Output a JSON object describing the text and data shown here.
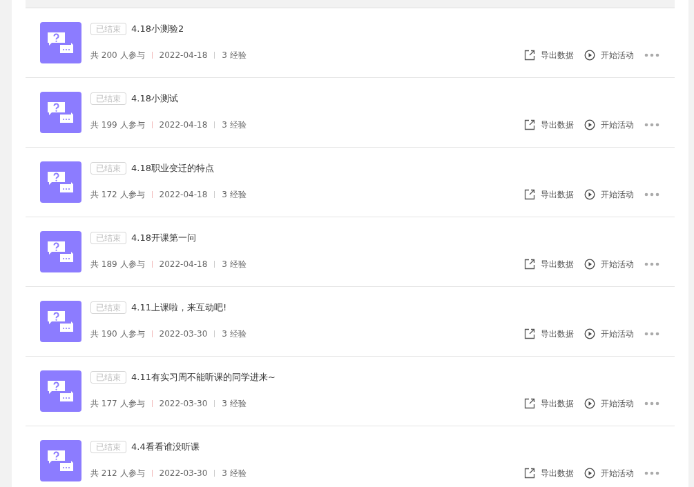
{
  "activities": [
    {
      "status": "已结束",
      "title": "4.18小测验2",
      "participants": "共 200 人参与",
      "date": "2022-04-18",
      "exp": "3 经验",
      "export": "导出数据",
      "start": "开始活动"
    },
    {
      "status": "已结束",
      "title": "4.18小测试",
      "participants": "共 199 人参与",
      "date": "2022-04-18",
      "exp": "3 经验",
      "export": "导出数据",
      "start": "开始活动"
    },
    {
      "status": "已结束",
      "title": "4.18职业变迁的特点",
      "participants": "共 172 人参与",
      "date": "2022-04-18",
      "exp": "3 经验",
      "export": "导出数据",
      "start": "开始活动"
    },
    {
      "status": "已结束",
      "title": "4.18开课第一问",
      "participants": "共 189 人参与",
      "date": "2022-04-18",
      "exp": "3 经验",
      "export": "导出数据",
      "start": "开始活动"
    },
    {
      "status": "已结束",
      "title": "4.11上课啦，来互动吧!",
      "participants": "共 190 人参与",
      "date": "2022-03-30",
      "exp": "3 经验",
      "export": "导出数据",
      "start": "开始活动"
    },
    {
      "status": "已结束",
      "title": "4.11有实习周不能听课的同学进来~",
      "participants": "共 177 人参与",
      "date": "2022-03-30",
      "exp": "3 经验",
      "export": "导出数据",
      "start": "开始活动"
    },
    {
      "status": "已结束",
      "title": "4.4看看谁没听课",
      "participants": "共 212 人参与",
      "date": "2022-03-30",
      "exp": "3 经验",
      "export": "导出数据",
      "start": "开始活动"
    }
  ]
}
